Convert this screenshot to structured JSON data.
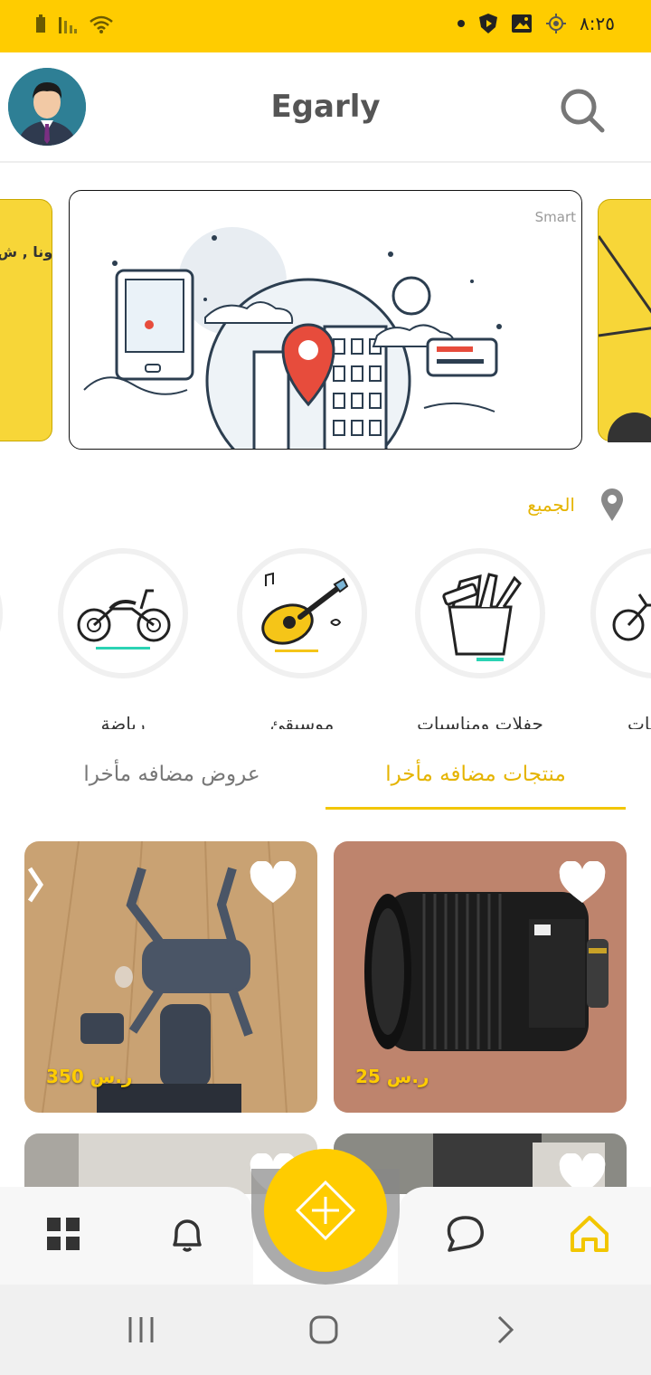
{
  "status_bar": {
    "time": "٨:٢٥",
    "bg_color": "#FFCC00",
    "icons_left": [
      "battery-icon",
      "signal-icon",
      "wifi-icon"
    ],
    "icons_right": [
      "dot-icon",
      "shield-icon",
      "image-icon",
      "location-target-icon"
    ]
  },
  "header": {
    "title": "Egarly",
    "avatar_icon": "user-avatar",
    "search_icon": "search-icon"
  },
  "banner": {
    "watermark": "Smart",
    "left_peek_text": "ونا , ش"
  },
  "location": {
    "label": "الجميع",
    "icon": "map-pin-icon"
  },
  "categories": [
    {
      "label": "حات",
      "icon": "motorcycle-icon"
    },
    {
      "label": "حفلات ومناسبات",
      "icon": "toolbox-icon"
    },
    {
      "label": "موسيقئ",
      "icon": "guitar-icon"
    },
    {
      "label": "رياضة",
      "icon": "motorcycle-icon"
    }
  ],
  "tabs": {
    "active": "منتجات   مضافه مأخرا",
    "inactive": "عروض   مضافه مأخرا"
  },
  "products": [
    {
      "price": "25 ر.س",
      "subject": "camera-lens",
      "favorite_icon": "heart-icon"
    },
    {
      "price": "350 ر.س",
      "subject": "drone",
      "favorite_icon": "heart-icon"
    }
  ],
  "bottom_nav": {
    "items": [
      "home-icon",
      "chat-icon",
      "add-icon",
      "bell-icon",
      "grid-icon"
    ],
    "accent": "#FFCC00"
  },
  "system_nav": {
    "items": [
      "recent-apps-icon",
      "home-circle-icon",
      "back-icon"
    ]
  }
}
